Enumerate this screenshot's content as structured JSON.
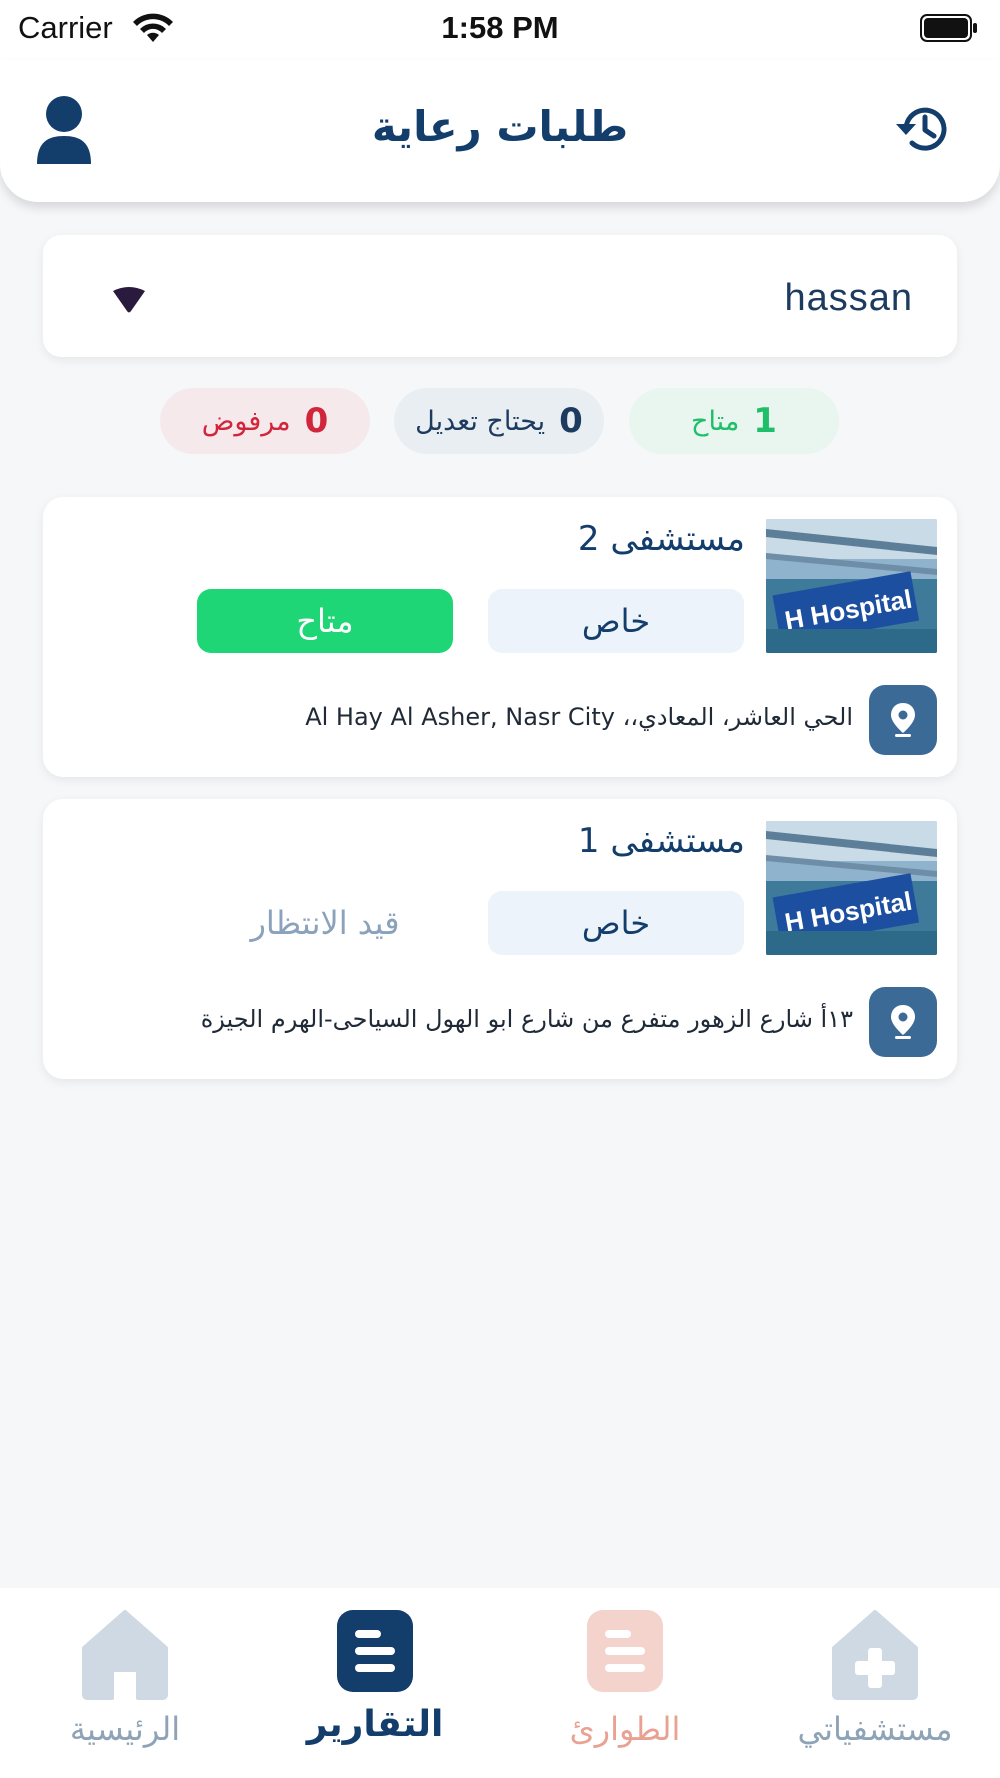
{
  "status_bar": {
    "carrier": "Carrier",
    "time": "1:58 PM"
  },
  "header": {
    "title": "طلبات رعاية",
    "left_icon": "user-icon",
    "right_icon": "history-icon"
  },
  "filter": {
    "selected": "hassan"
  },
  "stats": {
    "available": {
      "count": "1",
      "label": "متاح",
      "color": "#1fbf6a"
    },
    "needs_edit": {
      "count": "0",
      "label": "يحتاج تعديل",
      "color": "#1d3a5f"
    },
    "rejected": {
      "count": "0",
      "label": "مرفوض",
      "color": "#d0253b"
    }
  },
  "hospitals": [
    {
      "name": "مستشفى 2",
      "type": "خاص",
      "status": "متاح",
      "address": "الحي العاشر، المعادي،، Al Hay Al Asher, Nasr City"
    },
    {
      "name": "مستشفى 1",
      "type": "خاص",
      "status": "قيد الانتظار",
      "address": "١٣أ شارع الزهور متفرع من شارع ابو الهول السياحى-الهرم الجيزة"
    }
  ],
  "bottom_nav": {
    "home": {
      "label": "الرئيسية",
      "color": "#8fa3b7"
    },
    "reports": {
      "label": "التقارير",
      "color": "#133d6a"
    },
    "emergency": {
      "label": "الطوارئ",
      "color": "#e9a292"
    },
    "hospitals": {
      "label": "مستشفياتي",
      "color": "#8fa3b7"
    }
  },
  "colors": {
    "primary": "#133d6a",
    "success": "#1ed676",
    "pin_button": "#3c6a97"
  }
}
